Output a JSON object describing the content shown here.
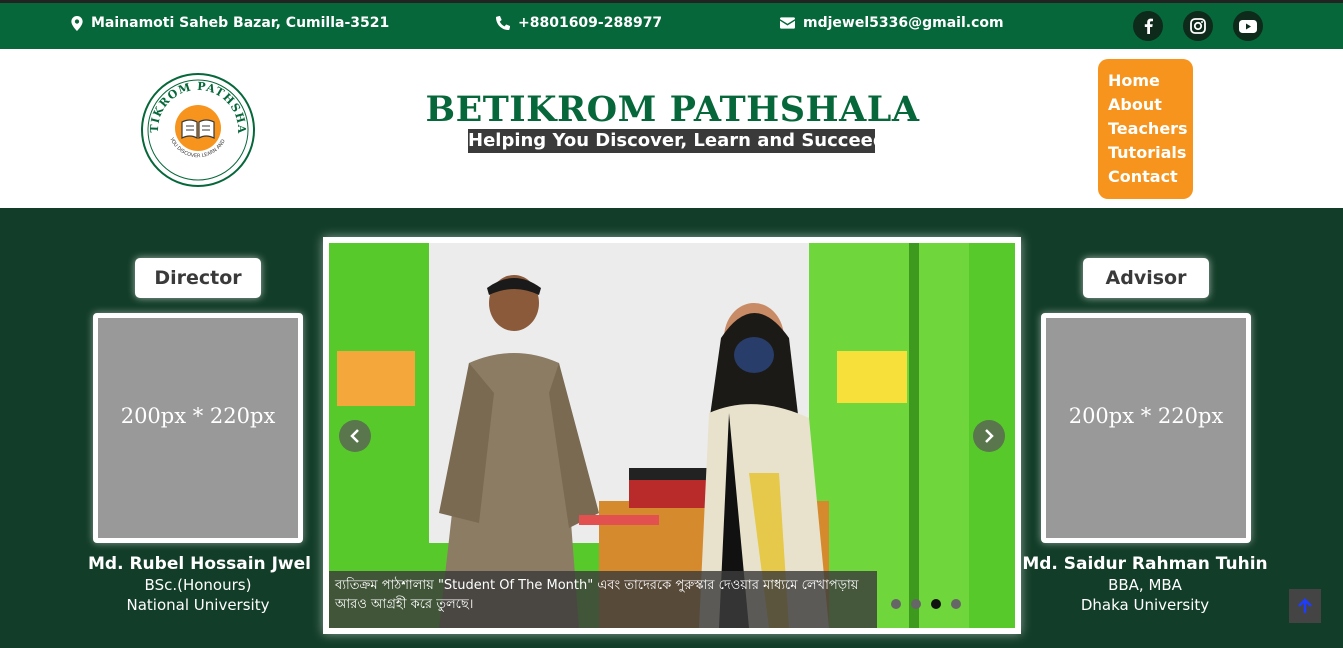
{
  "topbar": {
    "address": "Mainamoti Saheb Bazar, Cumilla-3521",
    "phone": "+8801609-288977",
    "email": "mdjewel5336@gmail.com",
    "social": [
      "facebook-icon",
      "instagram-icon",
      "youtube-icon"
    ]
  },
  "header": {
    "logo_text": "BETIKROM PATHSHALA",
    "logo_subtext": "HELPING YOU DISCOVER LEARN AND SUCCEED",
    "title": "BETIKROM PATHSHALA",
    "tagline": "Helping You Discover, Learn and Succeed"
  },
  "nav": {
    "items": [
      "Home",
      "About",
      "Teachers",
      "Tutorials",
      "Contact"
    ]
  },
  "director": {
    "role": "Director",
    "placeholder": "200px * 220px",
    "name": "Md. Rubel Hossain Jwel",
    "degree": "BSc.(Honours)",
    "institution": "National University"
  },
  "advisor": {
    "role": "Advisor",
    "placeholder": "200px * 220px",
    "name": "Md. Saidur Rahman Tuhin",
    "degree": "BBA, MBA",
    "institution": "Dhaka University"
  },
  "slider": {
    "caption": "ব্যতিক্রম পাঠশালায় \"Student Of The Month\" এবং তাদেরকে পুরুস্কার দেওয়ার মাধ্যমে লেখাপড়ায় আরও আগ্রহী করে তুলছে।",
    "active_slide": 3,
    "slide_count": 4
  },
  "colors": {
    "primary_green": "#06683a",
    "dark_green": "#123d28",
    "accent_orange": "#f7941d"
  }
}
